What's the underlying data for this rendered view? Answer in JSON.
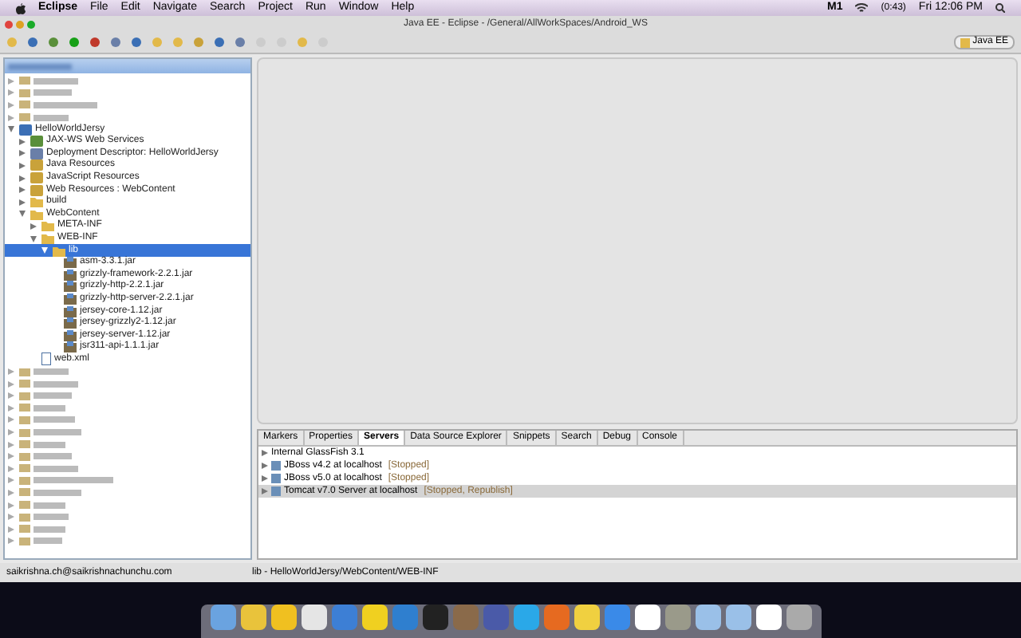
{
  "menubar": {
    "items": [
      "Eclipse",
      "File",
      "Edit",
      "Navigate",
      "Search",
      "Project",
      "Run",
      "Window",
      "Help"
    ],
    "extras": [
      "M1",
      "(0:43)",
      "Fri 12:06 PM"
    ]
  },
  "window": {
    "title": "Java EE - Eclipse - /General/AllWorkSpaces/Android_WS"
  },
  "perspective": {
    "label": "Java EE"
  },
  "project_explorer": {
    "tree": [
      {
        "label": "HelloWorldJersy",
        "kind": "project",
        "expanded": true,
        "selected": false,
        "children": [
          {
            "label": "JAX-WS Web Services",
            "kind": "services",
            "expanded": false,
            "selected": false
          },
          {
            "label": "Deployment Descriptor: HelloWorldJersy",
            "kind": "descriptor",
            "expanded": false,
            "selected": false
          },
          {
            "label": "Java Resources",
            "kind": "resources",
            "expanded": false,
            "selected": false
          },
          {
            "label": "JavaScript Resources",
            "kind": "resources",
            "expanded": false,
            "selected": false
          },
          {
            "label": "Web Resources : WebContent",
            "kind": "resources",
            "expanded": false,
            "selected": false
          },
          {
            "label": "build",
            "kind": "folder",
            "expanded": false,
            "selected": false
          },
          {
            "label": "WebContent",
            "kind": "folder",
            "expanded": true,
            "selected": false,
            "children": [
              {
                "label": "META-INF",
                "kind": "folder",
                "expanded": false,
                "selected": false
              },
              {
                "label": "WEB-INF",
                "kind": "folder",
                "expanded": true,
                "selected": false,
                "children": [
                  {
                    "label": "lib",
                    "kind": "folder",
                    "expanded": true,
                    "selected": true,
                    "children": [
                      {
                        "label": "asm-3.3.1.jar",
                        "kind": "jar",
                        "selected": false
                      },
                      {
                        "label": "grizzly-framework-2.2.1.jar",
                        "kind": "jar",
                        "selected": false
                      },
                      {
                        "label": "grizzly-http-2.2.1.jar",
                        "kind": "jar",
                        "selected": false
                      },
                      {
                        "label": "grizzly-http-server-2.2.1.jar",
                        "kind": "jar",
                        "selected": false
                      },
                      {
                        "label": "jersey-core-1.12.jar",
                        "kind": "jar",
                        "selected": false
                      },
                      {
                        "label": "jersey-grizzly2-1.12.jar",
                        "kind": "jar",
                        "selected": false
                      },
                      {
                        "label": "jersey-server-1.12.jar",
                        "kind": "jar",
                        "selected": false
                      },
                      {
                        "label": "jsr311-api-1.1.1.jar",
                        "kind": "jar",
                        "selected": false
                      }
                    ]
                  }
                ]
              },
              {
                "label": "web.xml",
                "kind": "xml",
                "selected": false
              }
            ]
          }
        ]
      }
    ]
  },
  "bottom_panel": {
    "tabs": [
      {
        "label": "Markers",
        "selected": false
      },
      {
        "label": "Properties",
        "selected": false
      },
      {
        "label": "Servers",
        "selected": true
      },
      {
        "label": "Data Source Explorer",
        "selected": false
      },
      {
        "label": "Snippets",
        "selected": false
      },
      {
        "label": "Search",
        "selected": false
      },
      {
        "label": "Debug",
        "selected": false
      },
      {
        "label": "Console",
        "selected": false
      }
    ],
    "servers": [
      {
        "name": "Internal GlassFish 3.1",
        "selected": false
      },
      {
        "name": "JBoss v4.2 at localhost",
        "status": "[Stopped]",
        "selected": false
      },
      {
        "name": "JBoss v5.0 at localhost",
        "status": "[Stopped]",
        "selected": false
      },
      {
        "name": "Tomcat v7.0 Server at localhost",
        "status": "[Stopped, Republish]",
        "selected": true
      }
    ]
  },
  "status_bar": {
    "user": "saikrishna.ch@saikrishnachunchu.com",
    "path": "lib - HelloWorldJersy/WebContent/WEB-INF"
  }
}
